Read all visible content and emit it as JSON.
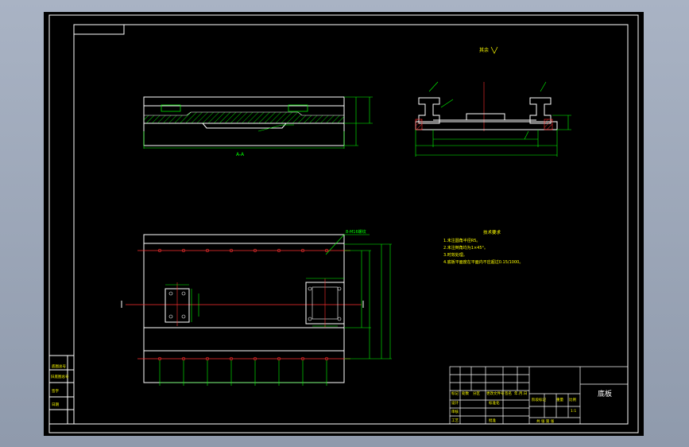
{
  "drawing": {
    "title": "底板",
    "section_label": "A-A",
    "view_label": "其余",
    "notes_title": "技术要求",
    "notes": [
      "1.未注圆角半径R5。",
      "2.未注倒角均为1×45°。",
      "3.时效处理。",
      "4.底板平面度在平面内不应超过0.15/1000。"
    ],
    "hole_callout": "8-M16螺纹",
    "left_block": {
      "rows": [
        "底图总号",
        "旧底图总号",
        "签字",
        "日期"
      ]
    },
    "title_block": {
      "row_labels": [
        "标记",
        "处数",
        "分区",
        "更改文件号",
        "签名",
        "年.月.日"
      ],
      "design": "设计",
      "standardize": "标准化",
      "check": "审核",
      "process": "工艺",
      "approve": "批准",
      "stage_mark": "阶段标记",
      "weight": "重量",
      "scale": "比例",
      "sheet_text": "共 张 第 张",
      "scale_value": "1:1"
    },
    "colors": {
      "border": "#ffffff",
      "geometry": "#ffffff",
      "dimension": "#00ff00",
      "centerline": "#ff0000",
      "text_yellow": "#ffff00",
      "hatch": "#00ff00"
    }
  }
}
